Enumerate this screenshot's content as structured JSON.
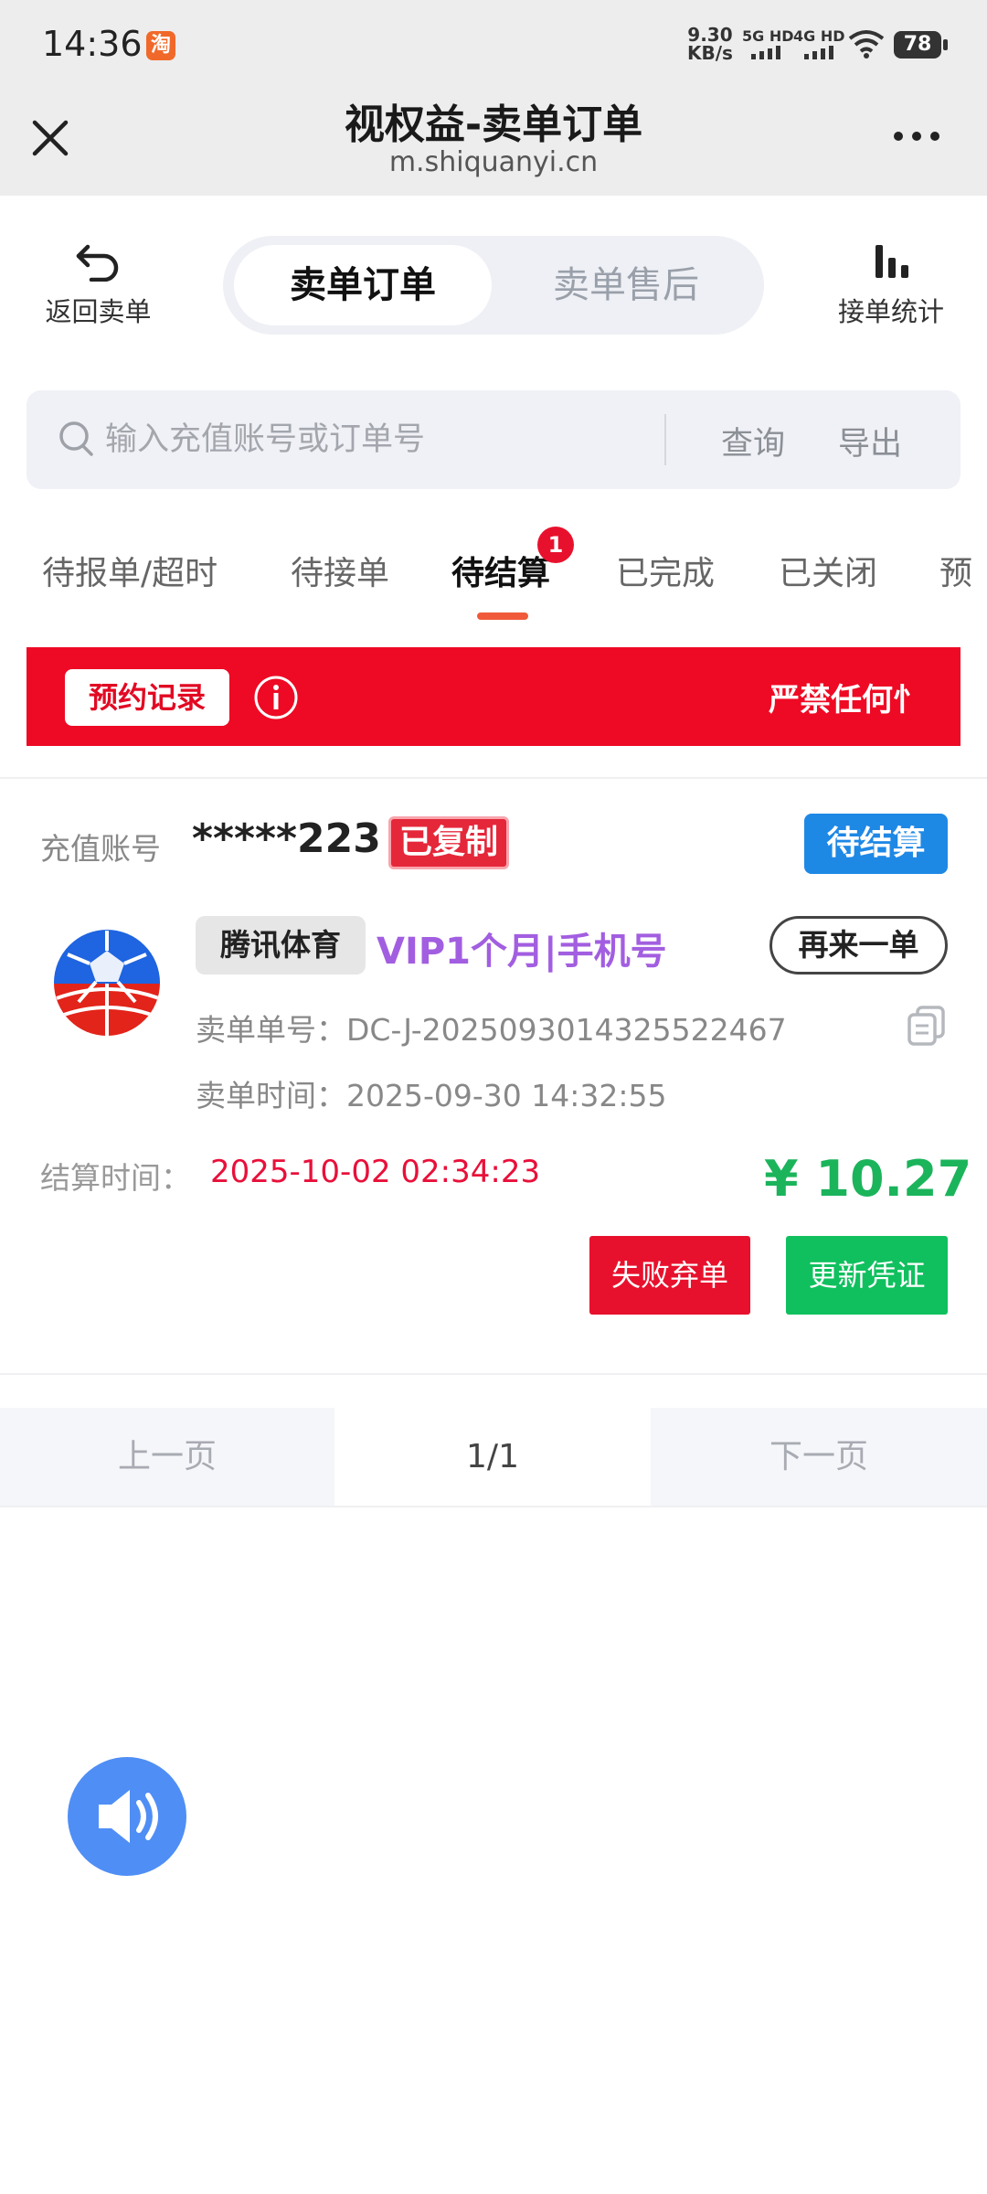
{
  "status_bar": {
    "time": "14:36",
    "app_icon_text": "淘",
    "net_speed_value": "9.30",
    "net_speed_unit": "KB/s",
    "sim1_label": "5G HD",
    "sim2_label": "4G HD",
    "battery": "78"
  },
  "titlebar": {
    "title": "视权益-卖单订单",
    "url": "m.shiquanyi.cn"
  },
  "topnav": {
    "back_label": "返回卖单",
    "segments": [
      "卖单订单",
      "卖单售后"
    ],
    "stats_label": "接单统计"
  },
  "search": {
    "placeholder": "输入充值账号或订单号",
    "query_label": "查询",
    "export_label": "导出"
  },
  "tabs": {
    "items": [
      "待报单/超时",
      "待接单",
      "待结算",
      "已完成",
      "已关闭",
      "预"
    ],
    "active_index": 2,
    "badge": "1"
  },
  "banner": {
    "button_label": "预约记录",
    "marquee": "严禁任何忄"
  },
  "order": {
    "account_label": "充值账号",
    "account_value": "*****223",
    "copied_label": "已复制",
    "status": "待结算",
    "brand": "腾讯体育",
    "product": "VIP1个月|手机号",
    "reorder_label": "再来一单",
    "order_no_label": "卖单单号：",
    "order_no": "DC-J-20250930143255224​67",
    "order_time_label": "卖单时间：",
    "order_time": "2025-09-30 14:32:55",
    "settle_label": "结算时间：",
    "settle_time": "2025-10-02 02:34:23",
    "price": "¥ 10.27",
    "fail_label": "失败弃单",
    "update_label": "更新凭证"
  },
  "pager": {
    "prev": "上一页",
    "current": "1/1",
    "next": "下一页"
  },
  "colors": {
    "accent_red": "#ee0a24",
    "status_blue": "#1e88e5",
    "price_green": "#1bb45b",
    "product_purple": "#a25ee0",
    "fab_blue": "#4f8ef5"
  }
}
